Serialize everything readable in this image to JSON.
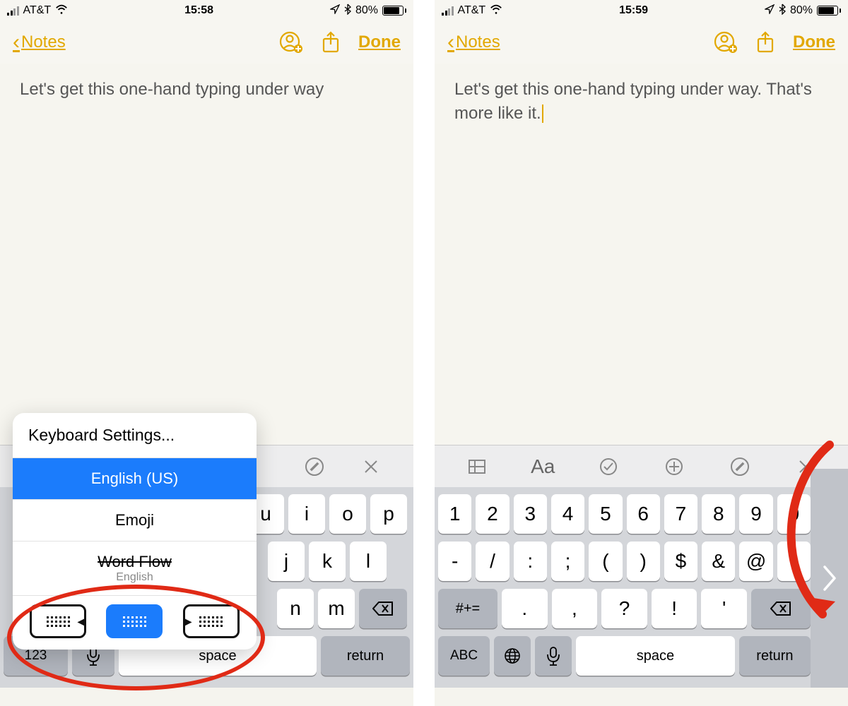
{
  "status": {
    "carrier": "AT&T",
    "battery_pct": "80%",
    "signal_active_bars": 2
  },
  "nav": {
    "back_label": "Notes",
    "done_label": "Done"
  },
  "left": {
    "time": "15:58",
    "note_text": "Let's get this one-hand typing under way",
    "popup": {
      "settings": "Keyboard Settings...",
      "english": "English (US)",
      "emoji": "Emoji",
      "wordflow": "Word Flow",
      "wordflow_sub": "English"
    },
    "kb_toolbar_icons": [
      "pencircle",
      "close"
    ],
    "row1": [
      "u",
      "i",
      "o",
      "p"
    ],
    "row2": [
      "j",
      "k",
      "l"
    ],
    "row3": [
      "n",
      "m"
    ],
    "bottom": {
      "numbers": "123",
      "space": "space",
      "return": "return"
    }
  },
  "right": {
    "time": "15:59",
    "note_text": "Let's get this one-hand typing under way. That's more like it.",
    "kb_toolbar_icons": [
      "table",
      "Aa",
      "check",
      "plus",
      "pencircle",
      "close"
    ],
    "row1": [
      "1",
      "2",
      "3",
      "4",
      "5",
      "6",
      "7",
      "8",
      "9",
      "0"
    ],
    "row2": [
      "-",
      "/",
      ":",
      ";",
      "(",
      ")",
      "$",
      "&",
      "@",
      "\""
    ],
    "row3_lead": "#+=",
    "row3": [
      ".",
      ",",
      "?",
      "!",
      "'"
    ],
    "bottom": {
      "abc": "ABC",
      "space": "space",
      "return": "return"
    }
  }
}
